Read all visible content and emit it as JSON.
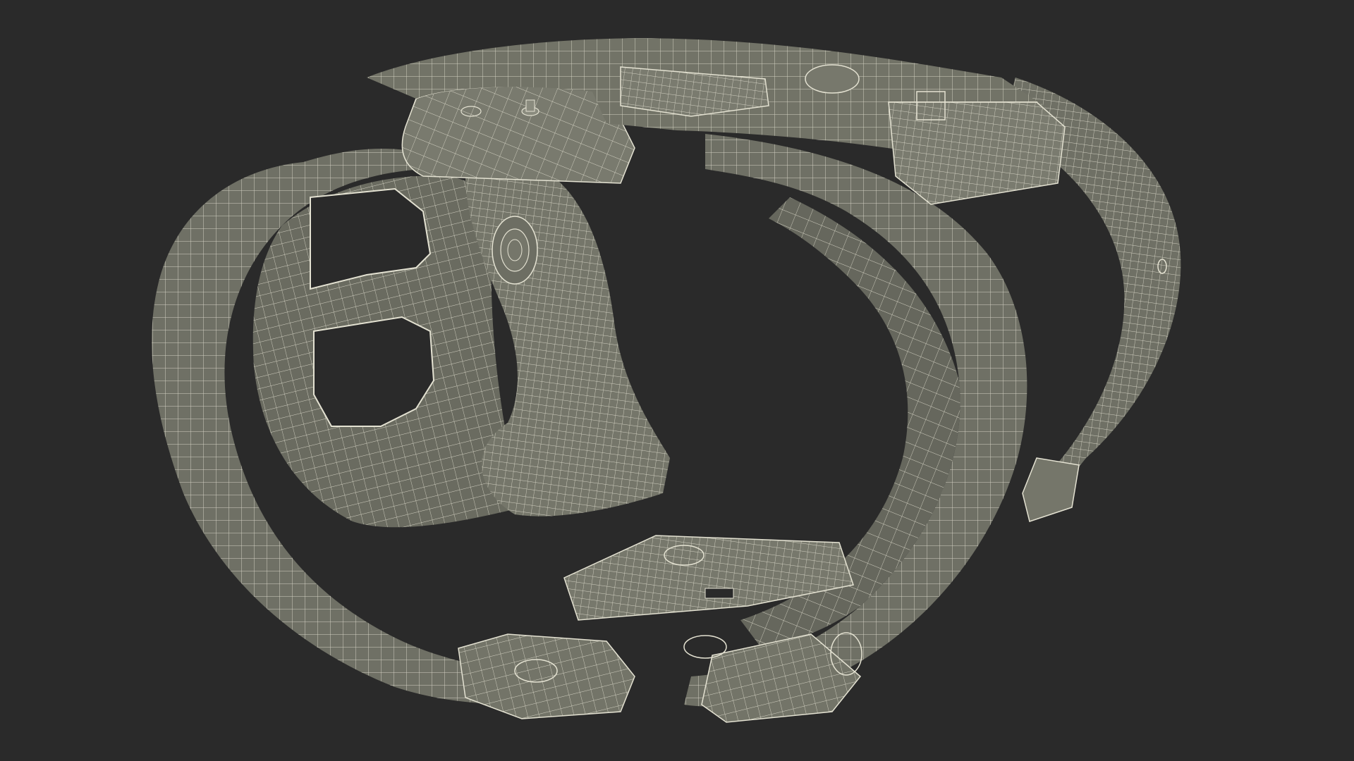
{
  "scene": {
    "subject": "wireframe-3d-model",
    "background_color": "#2a2a2a",
    "surface_color": "#6f7065",
    "surface_dark_color": "#5c5d54",
    "surface_light_color": "#7c7d71",
    "wire_color": "#e4e2d2",
    "hole_color": "#2a2a2a"
  }
}
